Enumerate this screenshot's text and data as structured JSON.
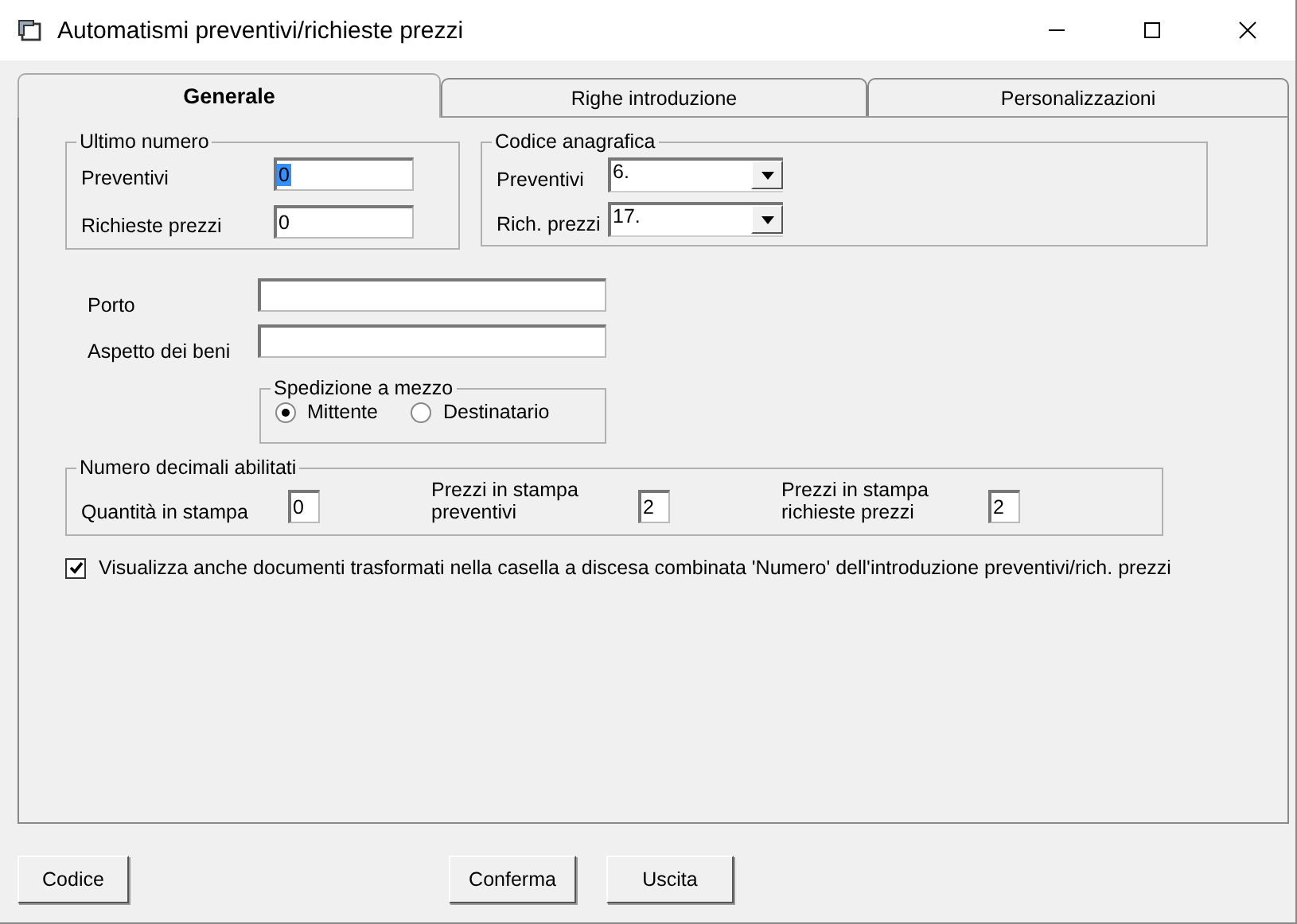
{
  "window": {
    "title": "Automatismi preventivi/richieste prezzi"
  },
  "tabs": [
    {
      "label": "Generale",
      "selected": true
    },
    {
      "label": "Righe introduzione",
      "selected": false
    },
    {
      "label": "Personalizzazioni",
      "selected": false
    }
  ],
  "ultimo_numero": {
    "title": "Ultimo numero",
    "fields": [
      {
        "label": "Preventivi",
        "value": "0",
        "focused": true
      },
      {
        "label": "Richieste prezzi",
        "value": "0",
        "focused": false
      }
    ]
  },
  "codice_anagrafica": {
    "title": "Codice anagrafica",
    "combos": [
      {
        "label": "Preventivi",
        "value": "6."
      },
      {
        "label": "Rich. prezzi",
        "value": "17."
      }
    ]
  },
  "text_fields": [
    {
      "label": "Porto"
    },
    {
      "label": "Aspetto dei beni"
    }
  ],
  "spedizione": {
    "title": "Spedizione a mezzo",
    "options": [
      {
        "label": "Mittente",
        "selected": true
      },
      {
        "label": "Destinatario",
        "selected": false
      }
    ]
  },
  "decimali": {
    "title": "Numero decimali abilitati",
    "fields": [
      {
        "label": "Quantità in stampa",
        "value": "0"
      },
      {
        "label": "Prezzi in stampa preventivi",
        "value": "2"
      },
      {
        "label": "Prezzi in stampa richieste prezzi",
        "value": "2"
      }
    ]
  },
  "checkbox": {
    "label": "Visualizza anche documenti trasformati nella casella a discesa combinata 'Numero' dell'introduzione preventivi/rich. prezzi",
    "checked": true
  },
  "buttons": [
    {
      "label": "Codice"
    },
    {
      "label": "Conferma"
    },
    {
      "label": "Uscita"
    }
  ]
}
